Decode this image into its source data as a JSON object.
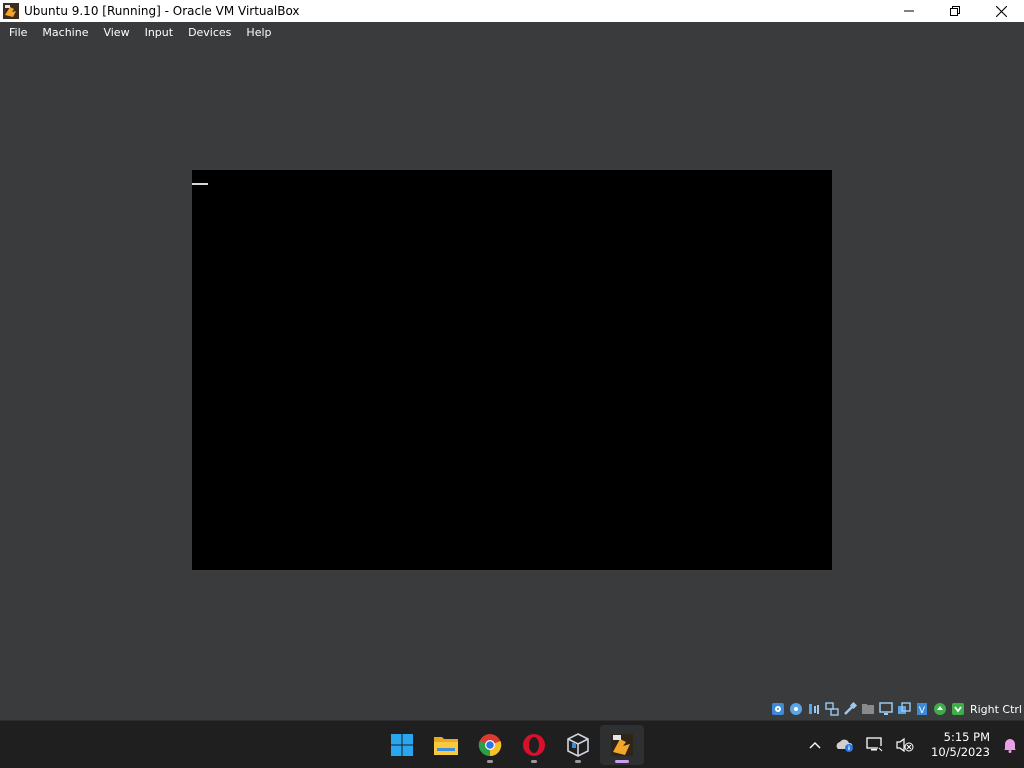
{
  "window": {
    "title": "Ubuntu 9.10 [Running] - Oracle VM VirtualBox",
    "controls": [
      "minimize",
      "maximize",
      "close"
    ]
  },
  "menu": {
    "items": [
      "File",
      "Machine",
      "View",
      "Input",
      "Devices",
      "Help"
    ]
  },
  "vm": {
    "screen_color": "#000000",
    "cursor": "_"
  },
  "statusbar": {
    "icons": [
      "hard-disk-icon",
      "optical-drive-icon",
      "audio-icon",
      "network-icon",
      "usb-icon",
      "shared-folders-icon",
      "display-icon",
      "recording-icon",
      "cpu-icon",
      "mouse-integration-icon",
      "keyboard-icon"
    ],
    "host_key": "Right Ctrl"
  },
  "taskbar": {
    "apps": [
      "windows-start-icon",
      "file-explorer-icon",
      "chrome-icon",
      "opera-icon",
      "virtualbox-icon",
      "virtualbox-vm-icon"
    ],
    "time": "5:15 PM",
    "date": "10/5/2023"
  },
  "colors": {
    "background": "#3a3b3d",
    "taskbar": "#1f1f20",
    "titlebar": "#ffffff",
    "accent_indicator": "#c9a0f0"
  }
}
